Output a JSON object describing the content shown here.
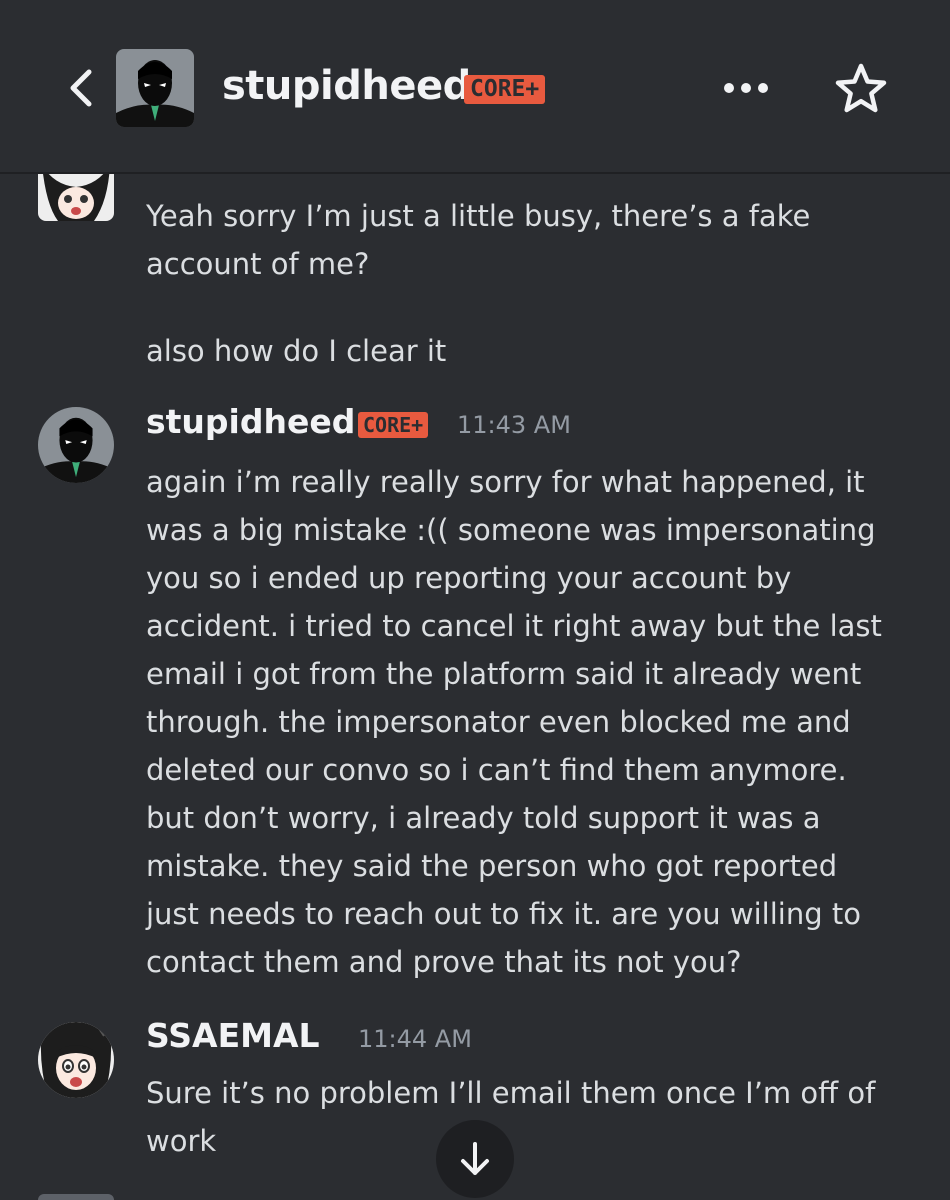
{
  "header": {
    "username": "stupidheed",
    "badge": "CORE+",
    "back_icon": "chevron-left-icon",
    "more_icon": "ellipsis-icon",
    "favorite_icon": "star-outline-icon"
  },
  "messages": [
    {
      "continuation": true,
      "lines": [
        "Yeah sorry I’m just a little busy, there’s a fake",
        "account of me?"
      ],
      "extra": "also how do I clear it"
    },
    {
      "author": "stupidheed",
      "badge": "CORE+",
      "time": "11:43 AM",
      "lines": [
        "again i’m really really sorry for what happened, it",
        "was a big mistake :(( someone was impersonating",
        "you so i ended up reporting your account by",
        "accident. i tried to cancel it right away but the last",
        "email i got from the platform said it already went",
        "through. the impersonator even blocked me and",
        "deleted our convo so i can’t find them anymore.",
        "but don’t worry, i already told support it was a",
        "mistake. they said the person who got reported",
        "just needs to reach out to fix it. are you willing to",
        "contact them and prove that its not you?"
      ]
    },
    {
      "author": "SSAEMAL",
      "time": "11:44 AM",
      "lines": [
        "Sure it’s no problem I’ll email them once I’m off of",
        "work"
      ]
    }
  ],
  "scroll_button_icon": "arrow-down-icon",
  "colors": {
    "background": "#2b2d31",
    "badge": "#e85a3f",
    "text": "#dbdee1",
    "timestamp": "#949ba4"
  }
}
